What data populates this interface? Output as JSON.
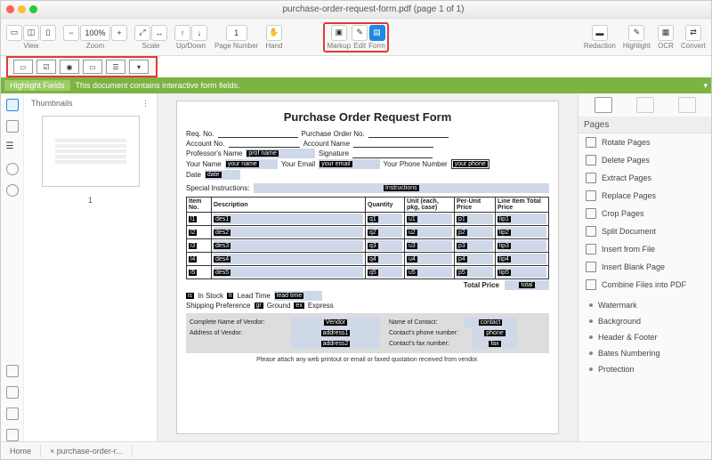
{
  "title": "purchase-order-request-form.pdf (page 1 of 1)",
  "toolbar": {
    "view": "View",
    "zoom": "Zoom",
    "zoomval": "100%",
    "scale": "Scale",
    "updown": "Up/Down",
    "pagenum": "Page Number",
    "pagenumval": "1",
    "hand": "Hand",
    "markup": "Markup",
    "edit": "Edit",
    "form": "Form",
    "redaction": "Redaction",
    "highlight": "Highlight",
    "ocr": "OCR",
    "convert": "Convert"
  },
  "greenbar": {
    "btn": "Highlight Fields",
    "msg": "This document contains interactive form fields."
  },
  "thumbs": {
    "header": "Thumbnails",
    "pagenum": "1"
  },
  "form": {
    "title": "Purchase Order Request Form",
    "labels": {
      "reqno": "Req. No.",
      "po": "Purchase Order No.",
      "acct": "Account No.",
      "acctname": "Account Name",
      "prof": "Professor's Name",
      "sig": "Signature",
      "yname": "Your Name",
      "yemail": "Your Email",
      "yphone": "Your Phone Number",
      "date": "Date",
      "spec": "Special Instructions:"
    },
    "values": {
      "prof": "prof name",
      "yname": "your name",
      "yemail": "your email",
      "yphone": "your phone",
      "date": "date",
      "spec": "Instructions"
    },
    "table": {
      "headers": [
        "Item No.",
        "Description",
        "Quantity",
        "Unit (each, pkg, case)",
        "Per-Unit Price",
        "Line Item Total Price"
      ],
      "rows": [
        {
          "item": "l1",
          "desc": "des1",
          "qty": "q1",
          "unit": "u1",
          "price": "p1",
          "lip": "lip1"
        },
        {
          "item": "l2",
          "desc": "des2",
          "qty": "q2",
          "unit": "u2",
          "price": "p2",
          "lip": "lip2"
        },
        {
          "item": "l3",
          "desc": "des3",
          "qty": "q3",
          "unit": "u3",
          "price": "p3",
          "lip": "lip3"
        },
        {
          "item": "l4",
          "desc": "des4",
          "qty": "q4",
          "unit": "u4",
          "price": "p4",
          "lip": "lip4"
        },
        {
          "item": "l5",
          "desc": "des5",
          "qty": "q5",
          "unit": "u5",
          "price": "p5",
          "lip": "lip5"
        }
      ],
      "totalprice": "Total Price",
      "totalval": "total"
    },
    "stock": {
      "instock": "In Stock",
      "leadtime": "Lead Time",
      "leadval": "lead time",
      "ship": "Shipping Preference",
      "ground": "Ground",
      "express": "Express",
      "is": "is",
      "lt": "lt",
      "gr": "gr",
      "ex": "ex"
    },
    "vendor": {
      "name": "Complete Name of Vendor:",
      "addr": "Address of Vendor:",
      "noc": "Name of Contact:",
      "cphone": "Contact's phone number:",
      "cfax": "Contact's fax number:",
      "vname": "Vendor",
      "a1": "address1",
      "a2": "address2",
      "contact": "contact",
      "phone": "phone",
      "fax": "fax"
    },
    "footnote": "Please attach any web printout or email or faxed quotation received from vendor."
  },
  "rpanel": {
    "heading": "Pages",
    "items": [
      "Rotate Pages",
      "Delete Pages",
      "Extract Pages",
      "Replace Pages",
      "Crop Pages",
      "Split Document",
      "Insert from File",
      "Insert Blank Page",
      "Combine Files into PDF"
    ],
    "more": [
      "Watermark",
      "Background",
      "Header & Footer",
      "Bates Numbering",
      "Protection"
    ]
  },
  "bottom": {
    "home": "Home",
    "tab": "purchase-order-r..."
  }
}
